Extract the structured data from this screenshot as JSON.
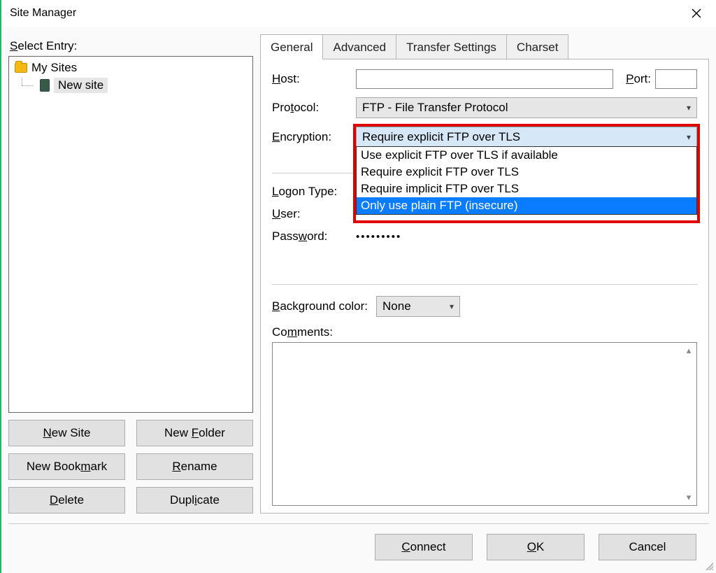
{
  "window": {
    "title": "Site Manager"
  },
  "left": {
    "select_label_pre": "S",
    "select_label_rest": "elect Entry:",
    "tree": {
      "root": "My Sites",
      "child": "New site"
    },
    "buttons": {
      "new_site_u": "N",
      "new_site_rest": "ew Site",
      "new_folder_pre": "New ",
      "new_folder_u": "F",
      "new_folder_rest": "older",
      "new_bookmark_pre": "New Book",
      "new_bookmark_u": "m",
      "new_bookmark_rest": "ark",
      "rename_u": "R",
      "rename_rest": "ename",
      "delete_u": "D",
      "delete_rest": "elete",
      "duplicate_pre": "Dupl",
      "duplicate_u": "i",
      "duplicate_rest": "cate"
    }
  },
  "tabs": {
    "general": "General",
    "advanced": "Advanced",
    "transfer": "Transfer Settings",
    "charset": "Charset"
  },
  "form": {
    "host_u": "H",
    "host_rest": "ost:",
    "port_u": "P",
    "port_rest": "ort:",
    "host_value": "",
    "port_value": "",
    "protocol_pre": "Pro",
    "protocol_u": "t",
    "protocol_rest": "ocol:",
    "protocol_value": "FTP - File Transfer Protocol",
    "encryption_u": "E",
    "encryption_rest": "ncryption:",
    "encryption_value": "Require explicit FTP over TLS",
    "encryption_options": [
      "Use explicit FTP over TLS if available",
      "Require explicit FTP over TLS",
      "Require implicit FTP over TLS",
      "Only use plain FTP (insecure)"
    ],
    "encryption_highlight_index": 3,
    "logon_pre": "",
    "logon_u": "L",
    "logon_rest": "ogon Type:",
    "user_u": "U",
    "user_rest": "ser:",
    "password_pre": "Pass",
    "password_u": "w",
    "password_rest": "ord:",
    "password_mask": "•••••••••",
    "bgcolor_u": "B",
    "bgcolor_rest": "ackground color:",
    "bgcolor_value": "None",
    "comments_pre": "Co",
    "comments_u": "m",
    "comments_rest": "ments:"
  },
  "dialog": {
    "connect_u": "C",
    "connect_rest": "onnect",
    "ok_u": "O",
    "ok_rest": "K",
    "cancel": "Cancel"
  }
}
